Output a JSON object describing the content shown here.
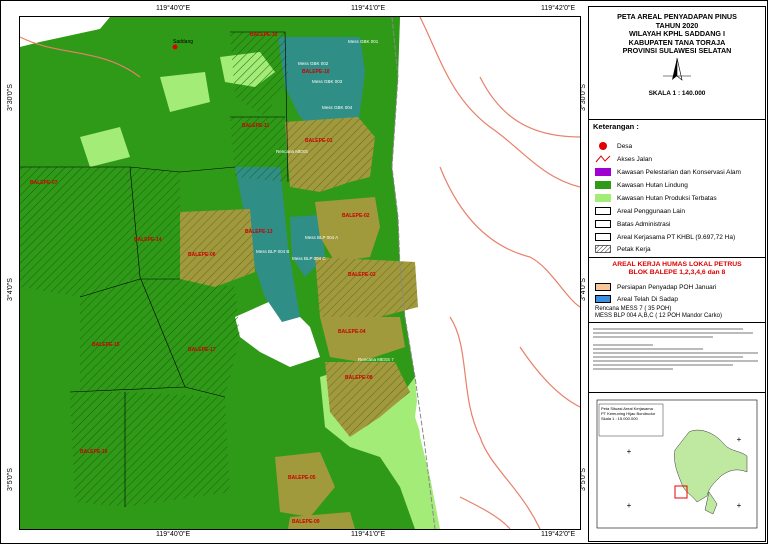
{
  "title_lines": [
    "PETA AREAL PENYADAPAN PINUS",
    "TAHUN 2020",
    "WILAYAH KPHL SADDANG I",
    "KABUPATEN TANA TORAJA",
    "PROVINSI SULAWESI SELATAN"
  ],
  "scale": "SKALA 1 : 140.000",
  "coords": {
    "top": [
      "119°40'0\"E",
      "119°41'0\"E",
      "119°42'0\"E"
    ],
    "bottom": [
      "119°40'0\"E",
      "119°41'0\"E",
      "119°42'0\"E"
    ],
    "left": [
      "3°30'0\"S",
      "3°4'0\"S",
      "3°5'0\"S"
    ],
    "right": [
      "3°30'0\"S",
      "3°4'0\"S",
      "3°5'0\"S"
    ]
  },
  "legend": {
    "heading": "Keterangan :",
    "items": [
      {
        "label": "Desa",
        "icon": "village-dot-icon",
        "color": "#e00000"
      },
      {
        "label": "Akses Jalan",
        "icon": "road-line-icon",
        "color": "#e00000"
      },
      {
        "label": "Kawasan Pelestarian dan Konservasi Alam",
        "icon": "conservation-swatch",
        "color": "#a000d0"
      },
      {
        "label": "Kawasan Hutan Lindung",
        "icon": "protected-forest-swatch",
        "color": "#2f9a18"
      },
      {
        "label": "Kawasan Hutan Produksi Terbatas",
        "icon": "production-forest-swatch",
        "color": "#a4ec78"
      },
      {
        "label": "Areal Penggunaan Lain",
        "icon": "other-use-swatch",
        "color": "#ffffff"
      },
      {
        "label": "Batas Administrasi",
        "icon": "admin-boundary-swatch",
        "color": "#ffffff"
      },
      {
        "label": "Areal Kerjasama PT KHBL (9.697,72 Ha)",
        "icon": "cooperation-area-swatch",
        "color": "#ffffff"
      },
      {
        "label": "Petak Kerja",
        "icon": "hatched-swatch",
        "color": "#ffffff"
      }
    ]
  },
  "work_area": {
    "title_lines": [
      "AREAL KERJA HUMAS LOKAL PETRUS",
      "BLOK BALEPE 1,2,3,4,6 dan 8"
    ],
    "items": [
      {
        "label": "Persiapan Penyadap POH Januari",
        "color": "#f8c89a",
        "icon": "preparation-swatch"
      },
      {
        "label": "Areal Telah Di Sadap",
        "color": "#3a8fe0",
        "icon": "tapped-area-swatch"
      }
    ],
    "notes": [
      "Rencana MESS 7 ( 35 POH)",
      "MESS BLP 004 A,B,C ( 12 POH Mandor Carko)"
    ]
  },
  "inset": {
    "label_lines": [
      "Peta Situasi Areal Kerjasama",
      "PT Kemuning Hijau Borobudur",
      "Skala 1 : 15.000.000"
    ]
  },
  "map": {
    "village": "Saddang",
    "block_labels": [
      "BALEPE-01",
      "BALEPE-02",
      "BALEPE-03",
      "BALEPE-04",
      "BALEPE-05",
      "BALEPE-06",
      "BALEPE-07",
      "BALEPE-08",
      "BALEPE-09",
      "BALEPE-10",
      "BALEPE-11",
      "BALEPE-12",
      "BALEPE-13",
      "BALEPE-14",
      "BALEPE-15",
      "BALEPE-16",
      "BALEPE-17"
    ],
    "mess_labels": [
      "Mess GBK 001",
      "Mess GBK 002",
      "Mess GBK 003",
      "Mess GBK 004",
      "Rencana MESS",
      "Mess BLP 004 A",
      "Mess BLP 004 B",
      "Mess BLP 004 C",
      "Rencana MESS 7"
    ]
  },
  "colors": {
    "protected": "#2f9a18",
    "production": "#a4ec78",
    "olive": "#a09a3c",
    "tapped": "#2f8f86",
    "road": "#e8806a"
  }
}
